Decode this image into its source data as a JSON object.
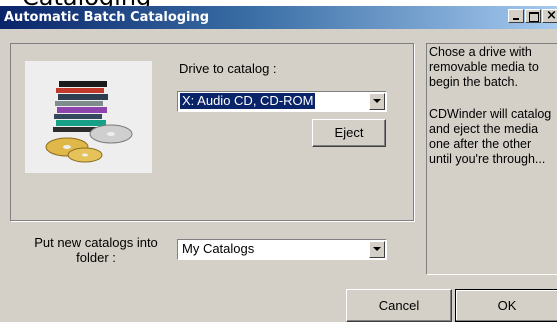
{
  "background_title": "Cataloging",
  "window": {
    "title": "Automatic Batch Cataloging"
  },
  "drive": {
    "label": "Drive to catalog :",
    "selected": "X:  Audio CD, CD-ROM",
    "eject_label": "Eject"
  },
  "folder": {
    "label": "Put new catalogs into folder :",
    "selected": "My Catalogs"
  },
  "help": {
    "text1": "Chose a drive with removable media to begin the batch.",
    "text2": "CDWinder will catalog and eject the media one after the other until you're through..."
  },
  "buttons": {
    "cancel": "Cancel",
    "ok": "OK"
  },
  "icons": {
    "minimize": "minimize-icon",
    "maximize": "maximize-icon",
    "close": "close-icon",
    "cd_stack": "cd-stack-icon",
    "dropdown": "chevron-down-icon"
  },
  "colors": {
    "titlebar_start": "#0a246a",
    "titlebar_end": "#a6caf0",
    "face": "#d4d0c8",
    "selection": "#0a246a"
  }
}
